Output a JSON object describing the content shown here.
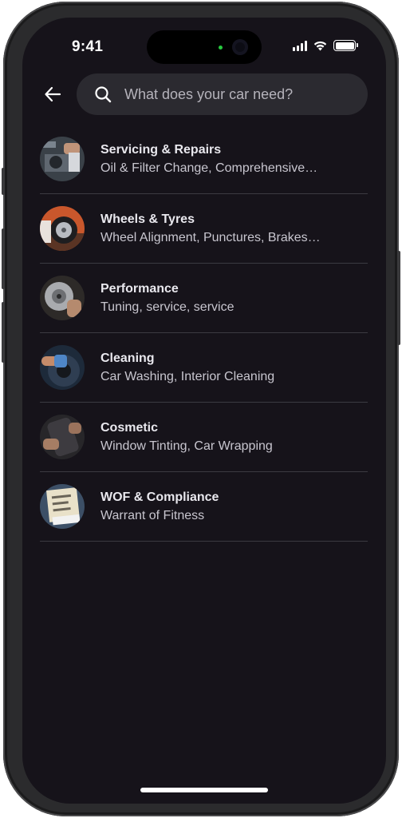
{
  "status_bar": {
    "time": "9:41"
  },
  "header": {
    "back_icon": "arrow-left-icon",
    "search": {
      "icon": "search-icon",
      "placeholder": "What does your car need?",
      "value": ""
    }
  },
  "categories": [
    {
      "title": "Servicing & Repairs",
      "subtitle": "Oil & Filter Change, Comprehensive…",
      "image": "mechanic-engine-photo"
    },
    {
      "title": "Wheels & Tyres",
      "subtitle": "Wheel Alignment, Punctures, Brakes…",
      "image": "wheel-tyre-photo"
    },
    {
      "title": "Performance",
      "subtitle": "Tuning, service, service",
      "image": "brake-disc-photo"
    },
    {
      "title": "Cleaning",
      "subtitle": "Car Washing, Interior Cleaning",
      "image": "interior-cleaning-photo"
    },
    {
      "title": "Cosmetic",
      "subtitle": "Window Tinting, Car Wrapping",
      "image": "car-wrapping-photo"
    },
    {
      "title": "WOF & Compliance",
      "subtitle": "Warrant of Fitness",
      "image": "warrant-of-fitness-label-photo"
    }
  ],
  "colors": {
    "background": "#16131a",
    "search_bg": "#2b2a30",
    "divider": "#3b3a41",
    "title_text": "#e9e8ee",
    "subtitle_text": "#c8c6cf"
  }
}
